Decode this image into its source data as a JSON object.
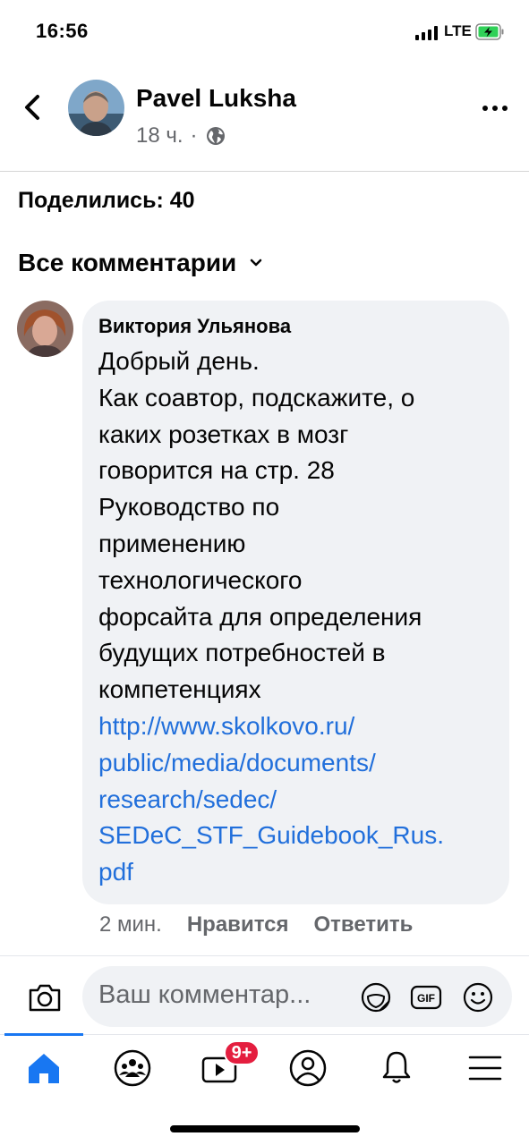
{
  "status_bar": {
    "time": "16:56",
    "network": "LTE"
  },
  "header": {
    "author_name": "Pavel Luksha",
    "time_ago": "18 ч.",
    "separator": "·"
  },
  "shares_text": "Поделились: 40",
  "comments_filter": "Все комментарии",
  "comment": {
    "author": "Виктория Ульянова",
    "lines": [
      "Добрый день.",
      "Как соавтор, подскажите, о",
      "каких розетках в мозг",
      "говорится на стр. 28",
      "Руководство по",
      "применению",
      "технологического",
      "форсайта для определения",
      "будущих потребностей в",
      "компетенциях"
    ],
    "link_lines": [
      "http://www.skolkovo.ru/",
      "public/media/documents/",
      "research/sedec/",
      "SEDeC_STF_Guidebook_Rus.",
      "pdf"
    ],
    "time": "2 мин.",
    "like_label": "Нравится",
    "reply_label": "Ответить"
  },
  "composer": {
    "placeholder": "Ваш комментар..."
  },
  "tabbar": {
    "badge": "9+"
  },
  "colors": {
    "accent": "#1877f2",
    "link": "#216fdb",
    "badge": "#e41e3f"
  },
  "icons": [
    "back-icon",
    "globe-icon",
    "more-icon",
    "chevron-down-icon",
    "camera-icon",
    "sticker-icon",
    "gif-icon",
    "emoji-icon",
    "home-icon",
    "groups-icon",
    "video-icon",
    "profile-icon",
    "bell-icon",
    "menu-icon"
  ]
}
